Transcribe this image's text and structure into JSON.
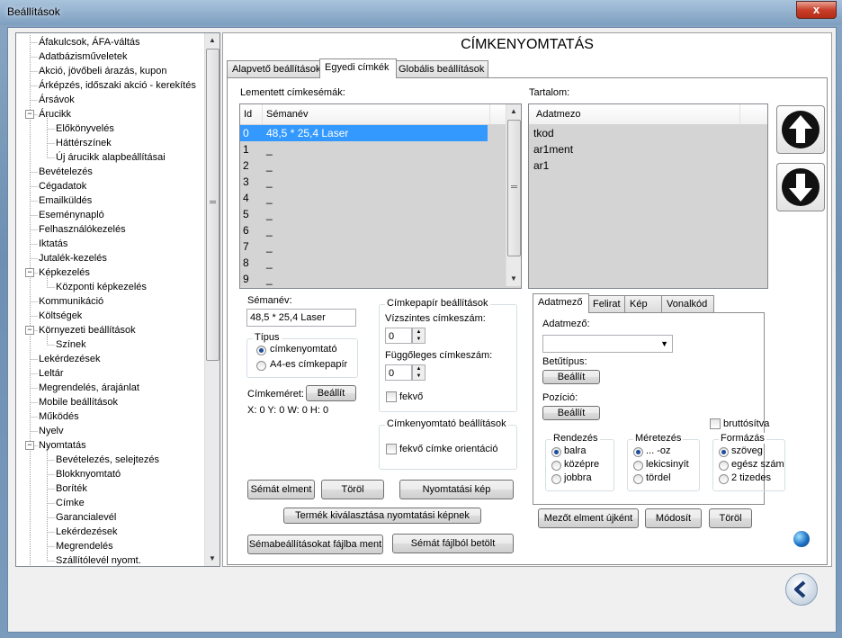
{
  "window": {
    "title": "Beállítások",
    "close_glyph": "x"
  },
  "tree": {
    "items": [
      {
        "label": "Áfakulcsok, ÁFA-váltás",
        "level": 1
      },
      {
        "label": "Adatbázisműveletek",
        "level": 1
      },
      {
        "label": "Akció, jövőbeli árazás, kupon",
        "level": 1
      },
      {
        "label": "Árképzés, időszaki akció - kerekítés",
        "level": 1
      },
      {
        "label": "Ársávok",
        "level": 1
      },
      {
        "label": "Árucikk",
        "level": 1,
        "expander": "−"
      },
      {
        "label": "Előkönyvelés",
        "level": 2
      },
      {
        "label": "Háttérszínek",
        "level": 2
      },
      {
        "label": "Új árucikk alapbeállításai",
        "level": 2
      },
      {
        "label": "Bevételezés",
        "level": 1
      },
      {
        "label": "Cégadatok",
        "level": 1
      },
      {
        "label": "Emailküldés",
        "level": 1
      },
      {
        "label": "Eseménynapló",
        "level": 1
      },
      {
        "label": "Felhasználókezelés",
        "level": 1
      },
      {
        "label": "Iktatás",
        "level": 1
      },
      {
        "label": "Jutalék-kezelés",
        "level": 1
      },
      {
        "label": "Képkezelés",
        "level": 1,
        "expander": "−"
      },
      {
        "label": "Központi képkezelés",
        "level": 2
      },
      {
        "label": "Kommunikáció",
        "level": 1
      },
      {
        "label": "Költségek",
        "level": 1
      },
      {
        "label": "Környezeti beállítások",
        "level": 1,
        "expander": "−"
      },
      {
        "label": "Színek",
        "level": 2
      },
      {
        "label": "Lekérdezések",
        "level": 1
      },
      {
        "label": "Leltár",
        "level": 1
      },
      {
        "label": "Megrendelés, árajánlat",
        "level": 1
      },
      {
        "label": "Mobile beállítások",
        "level": 1
      },
      {
        "label": "Működés",
        "level": 1
      },
      {
        "label": "Nyelv",
        "level": 1
      },
      {
        "label": "Nyomtatás",
        "level": 1,
        "expander": "−"
      },
      {
        "label": "Bevételezés, selejtezés",
        "level": 2
      },
      {
        "label": "Blokknyomtató",
        "level": 2
      },
      {
        "label": "Boríték",
        "level": 2
      },
      {
        "label": "Címke",
        "level": 2
      },
      {
        "label": "Garancialevél",
        "level": 2
      },
      {
        "label": "Lekérdezések",
        "level": 2
      },
      {
        "label": "Megrendelés",
        "level": 2
      },
      {
        "label": "Szállítólevél nyomt.",
        "level": 2
      }
    ]
  },
  "panel": {
    "title": "CÍMKENYOMTATÁS",
    "tabs": [
      "Alapvető beállítások",
      "Egyedi címkék",
      "Globális beállítások"
    ],
    "active_tab": "Egyedi címkék"
  },
  "schemas": {
    "label": "Lementett címkesémák:",
    "columns": [
      "Id",
      "Sémanév"
    ],
    "rows": [
      {
        "id": "0",
        "name": "48,5 * 25,4 Laser",
        "selected": true
      },
      {
        "id": "1",
        "name": "_"
      },
      {
        "id": "2",
        "name": "_"
      },
      {
        "id": "3",
        "name": "_"
      },
      {
        "id": "4",
        "name": "_"
      },
      {
        "id": "5",
        "name": "_"
      },
      {
        "id": "6",
        "name": "_"
      },
      {
        "id": "7",
        "name": "_"
      },
      {
        "id": "8",
        "name": "_"
      },
      {
        "id": "9",
        "name": "_"
      }
    ]
  },
  "content": {
    "label": "Tartalom:",
    "columns": [
      "Adatmezo"
    ],
    "rows": [
      "tkod",
      "ar1ment",
      "ar1"
    ]
  },
  "schema_form": {
    "name_label": "Sémanév:",
    "name_value": "48,5 * 25,4 Laser",
    "type_group": "Típus",
    "type_options": [
      "címkenyomtató",
      "A4-es címkepapír"
    ],
    "type_selected": 0,
    "size_label": "Címkeméret:",
    "size_button": "Beállít",
    "size_readout": "X: 0 Y: 0 W: 0 H: 0"
  },
  "paper": {
    "group": "Címkepapír beállítások",
    "horiz_label": "Vízszintes címkeszám:",
    "horiz_value": "0",
    "vert_label": "Függőleges címkeszám:",
    "vert_value": "0",
    "landscape_label": "fekvő"
  },
  "printer": {
    "group": "Címkenyomtató beállítások",
    "orientation_label": "fekvő címke orientáció"
  },
  "buttons": {
    "save_schema": "Sémát elment",
    "delete": "Töröl",
    "print_preview": "Nyomtatási kép",
    "select_product": "Termék kiválasztása nyomtatási képnek",
    "save_to_file": "Sémabeállításokat fájlba ment",
    "load_from_file": "Sémát fájlból betölt"
  },
  "field_tabs": {
    "tabs": [
      "Adatmező",
      "Felirat",
      "Kép",
      "Vonalkód"
    ],
    "active": "Adatmező",
    "field_label": "Adatmező:",
    "font_label": "Betűtípus:",
    "font_button": "Beállít",
    "pos_label": "Pozíció:",
    "pos_button": "Beállít",
    "gross_label": "bruttósítva",
    "align_group": "Rendezés",
    "align_options": [
      "balra",
      "középre",
      "jobbra"
    ],
    "align_selected": 0,
    "size_group": "Méretezés",
    "size_options": [
      "... -oz",
      "lekicsinyít",
      "tördel"
    ],
    "size_selected": 0,
    "format_group": "Formázás",
    "format_options": [
      "szöveg",
      "egész szám",
      "2 tizedes"
    ],
    "format_selected": 0
  },
  "field_buttons": {
    "save_new": "Mezőt elment újként",
    "modify": "Módosít",
    "delete": "Töröl"
  }
}
